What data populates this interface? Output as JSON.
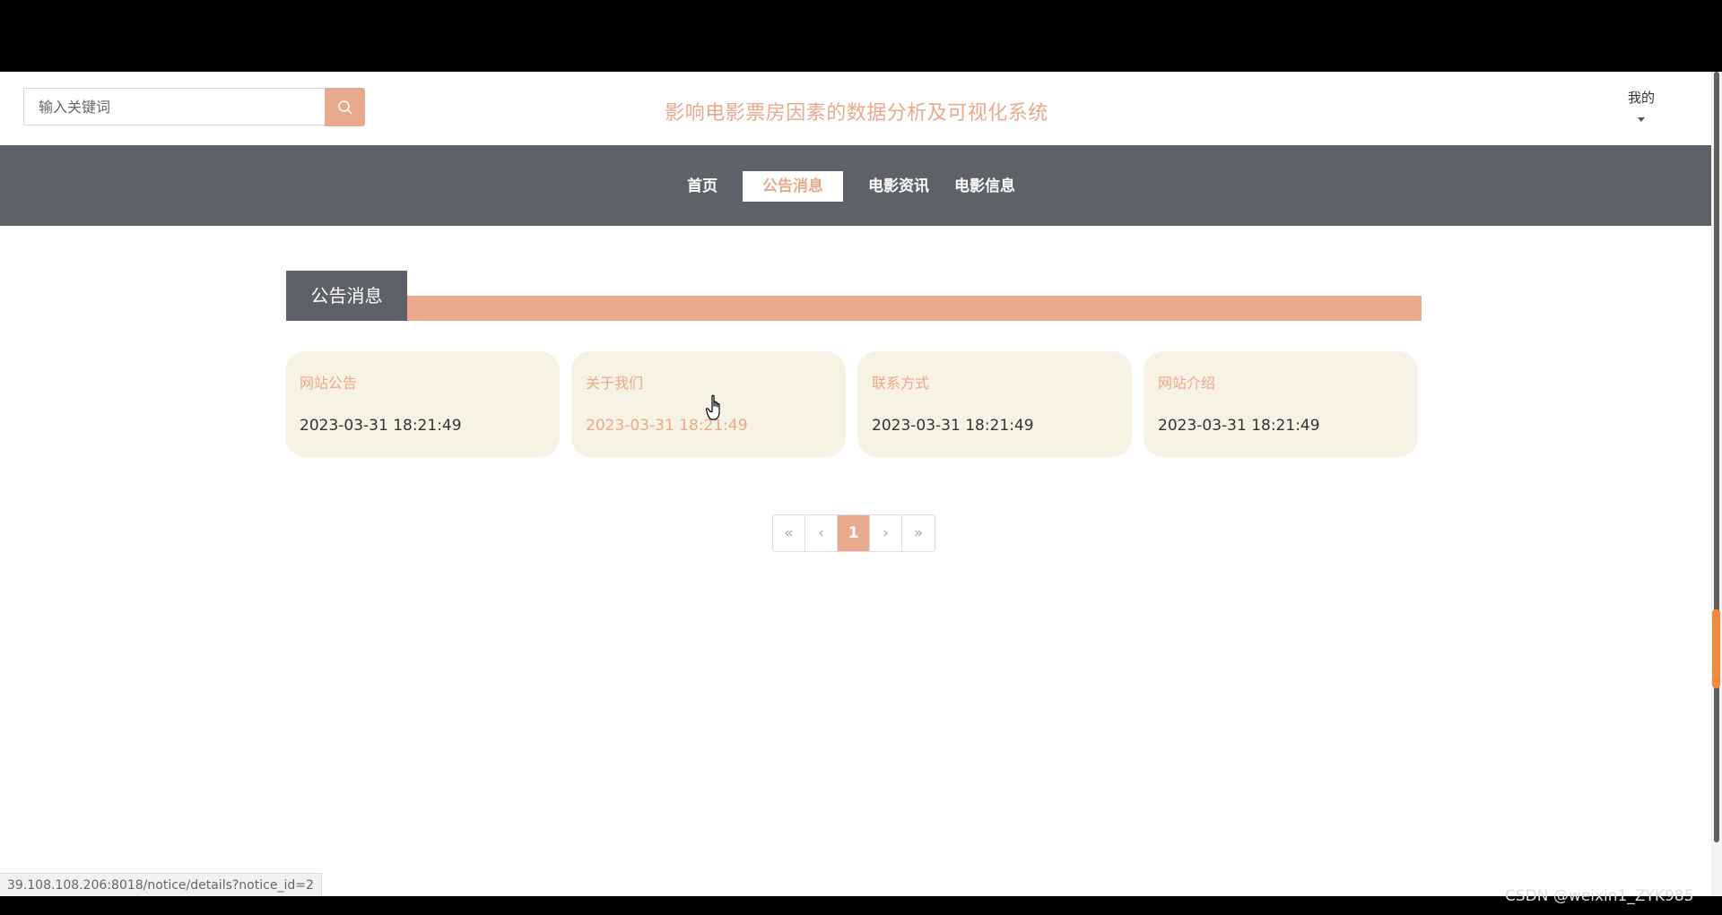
{
  "header": {
    "search_placeholder": "输入关键词",
    "site_title": "影响电影票房因素的数据分析及可视化系统",
    "user_menu_label": "我的"
  },
  "nav": {
    "items": [
      {
        "label": "首页"
      },
      {
        "label": "公告消息"
      },
      {
        "label": "电影资讯"
      },
      {
        "label": "电影信息"
      }
    ],
    "active_index": 1
  },
  "section": {
    "title": "公告消息"
  },
  "notices": [
    {
      "title": "网站公告",
      "date": "2023-03-31 18:21:49"
    },
    {
      "title": "关于我们",
      "date": "2023-03-31 18:21:49"
    },
    {
      "title": "联系方式",
      "date": "2023-03-31 18:21:49"
    },
    {
      "title": "网站介绍",
      "date": "2023-03-31 18:21:49"
    }
  ],
  "pagination": {
    "first": "«",
    "prev": "‹",
    "current": "1",
    "next": "›",
    "last": "»"
  },
  "status_bar": {
    "url": "39.108.108.206:8018/notice/details?notice_id=2"
  },
  "watermark": "CSDN @weixin1_ZYK985",
  "colors": {
    "accent": "#e8a98c",
    "nav_bg": "#5e6169",
    "card_bg": "#f8f2e4"
  }
}
